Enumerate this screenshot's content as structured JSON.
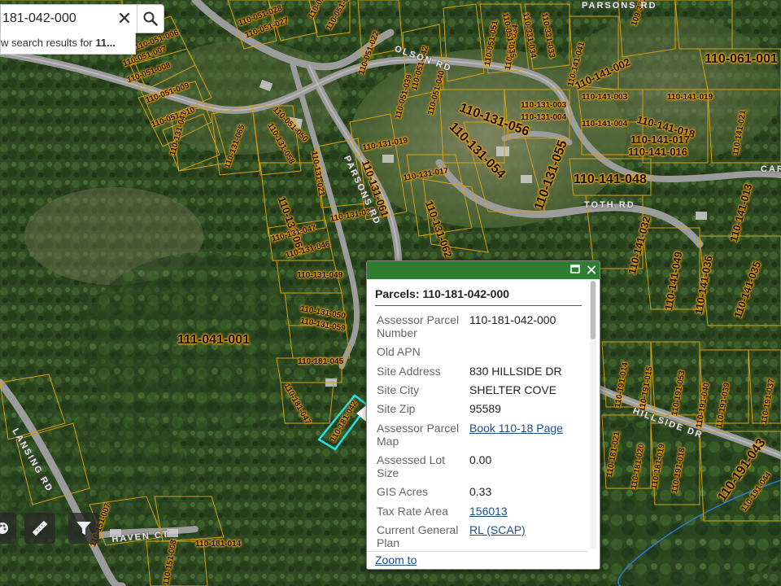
{
  "search": {
    "value": "181-042-000",
    "results_prefix": "w search results for ",
    "results_bold": "11..."
  },
  "map": {
    "parcel_outline_color": "#d4a017",
    "selected_parcel_color": "#26e0e0",
    "road_color": "#9a9a9a",
    "stream_color": "#2d7bd1",
    "parcel_labels": [
      "110-051-032",
      "110-051-033",
      "110-051-008",
      "110-051-007",
      "110-051-027",
      "110-051-028",
      "110-051-022",
      "110-051-042",
      "110-051-040",
      "110-051-039",
      "110-051-006",
      "110-051-010",
      "110-051-009",
      "110-051-050",
      "110-051-051",
      "110-051-034",
      "110-051-035",
      "110-331-034",
      "110-331-033",
      "109-331-031",
      "110-141-041",
      "110-141-002",
      "110-141-003",
      "110-131-003",
      "110-131-004",
      "110-141-019",
      "110-141-004",
      "110-141-018",
      "110-141-017",
      "110-141-016",
      "110-141-048",
      "110-131-056",
      "110-131-054",
      "110-131-055",
      "110-131-041",
      "110-131-065",
      "110-131-058",
      "110-131-019",
      "110-131-021",
      "110-131-061",
      "110-131-017",
      "110-131-062",
      "110-131-066",
      "110-131-047",
      "110-131-046",
      "110-131-049",
      "110-131-050",
      "110-131-059",
      "110-131-039",
      "110-181-045",
      "110-181-047",
      "110-181-042",
      "110-061-001",
      "111-041-001",
      "110-141-049",
      "110-141-036",
      "110-141-035",
      "110-141-032",
      "110-141-013",
      "110-191-014",
      "110-191-015",
      "110-191-053",
      "110-191-040",
      "110-191-039",
      "110-191-037",
      "110-181-020",
      "110-181-019",
      "110-181-021",
      "110-191-018",
      "110-191-043",
      "110-191-044",
      "110-151-007",
      "110-181-014",
      "110-151-008",
      "110-141-021"
    ],
    "road_labels": [
      "OLSON RD",
      "PARSONS RD",
      "PARSONS RD",
      "TOTH RD",
      "HILLSIDE DR",
      "HAVEN CT",
      "LANSING RD",
      "CAR"
    ]
  },
  "popup": {
    "title": "Parcels: 110-181-042-000",
    "attributes": [
      {
        "key": "Assessor Parcel Number",
        "value": "110-181-042-000",
        "link": false
      },
      {
        "key": "Old APN",
        "value": "",
        "link": false
      },
      {
        "key": "Site Address",
        "value": "830 HILLSIDE DR",
        "link": false
      },
      {
        "key": "Site City",
        "value": "SHELTER COVE",
        "link": false
      },
      {
        "key": "Site Zip",
        "value": "95589",
        "link": false
      },
      {
        "key": "Assessor Parcel Map",
        "value": "Book 110-18 Page",
        "link": true
      },
      {
        "key": "Assessed Lot Size",
        "value": "0.00",
        "link": false
      },
      {
        "key": "GIS Acres",
        "value": "0.33",
        "link": false
      },
      {
        "key": "Tax Rate Area",
        "value": "156013",
        "link": true
      },
      {
        "key": "Current General Plan",
        "value": "RL (SCAP)",
        "link": true
      }
    ],
    "zoom_to_label": "Zoom to"
  }
}
